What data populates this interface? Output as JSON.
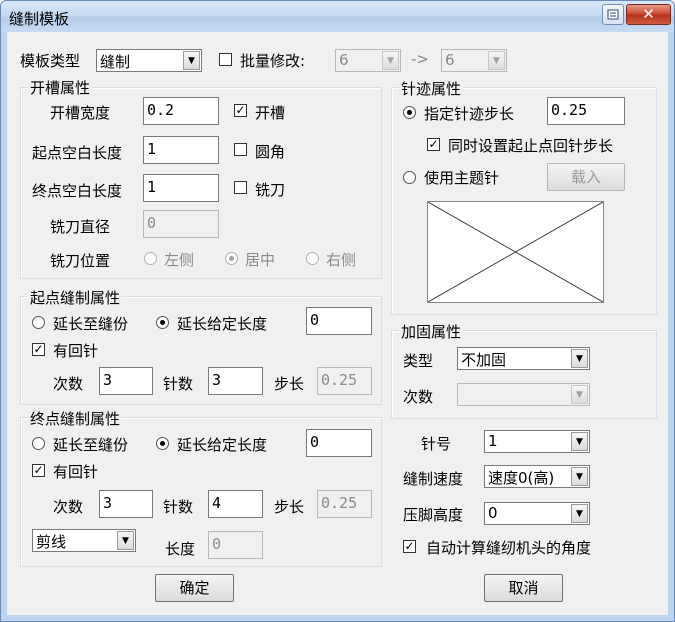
{
  "window": {
    "title": "缝制模板",
    "close_glyph": "✕"
  },
  "template_type": {
    "label": "模板类型",
    "value": "缝制"
  },
  "batch": {
    "label": "批量修改:",
    "from_value": "6",
    "arrow": "->",
    "to_value": "6"
  },
  "slot": {
    "title": "开槽属性",
    "width_label": "开槽宽度",
    "width_value": "0.2",
    "slot_label": "开槽",
    "start_blank_label": "起点空白长度",
    "start_blank_value": "1",
    "round_label": "圆角",
    "end_blank_label": "终点空白长度",
    "end_blank_value": "1",
    "mill_label": "铣刀",
    "diameter_label": "铣刀直径",
    "diameter_value": "0",
    "position_label": "铣刀位置",
    "pos_left": "左侧",
    "pos_center": "居中",
    "pos_right": "右侧"
  },
  "start_sew": {
    "title": "起点缝制属性",
    "extend_seam": "延长至缝份",
    "extend_len": "延长给定长度",
    "extend_value": "0",
    "backstitch": "有回针",
    "count_label": "次数",
    "count_value": "3",
    "stitch_label": "针数",
    "stitch_value": "3",
    "step_label": "步长",
    "step_value": "0.25"
  },
  "end_sew": {
    "title": "终点缝制属性",
    "extend_seam": "延长至缝份",
    "extend_len": "延长给定长度",
    "extend_value": "0",
    "backstitch": "有回针",
    "count_label": "次数",
    "count_value": "3",
    "stitch_label": "针数",
    "stitch_value": "4",
    "step_label": "步长",
    "step_value": "0.25",
    "cut_value": "剪线",
    "length_label": "长度",
    "length_value": "0"
  },
  "needle_trace": {
    "title": "针迹属性",
    "specify_label": "指定针迹步长",
    "specify_value": "0.25",
    "sync_label": "同时设置起止点回针步长",
    "theme_label": "使用主题针",
    "load_label": "载入"
  },
  "reinforce": {
    "title": "加固属性",
    "type_label": "类型",
    "type_value": "不加固",
    "count_label": "次数",
    "count_value": ""
  },
  "machine": {
    "needle_label": "针号",
    "needle_value": "1",
    "speed_label": "缝制速度",
    "speed_value": "速度0(高)",
    "foot_label": "压脚高度",
    "foot_value": "0",
    "auto_angle_label": "自动计算缝纫机头的角度"
  },
  "buttons": {
    "ok": "确定",
    "cancel": "取消"
  }
}
